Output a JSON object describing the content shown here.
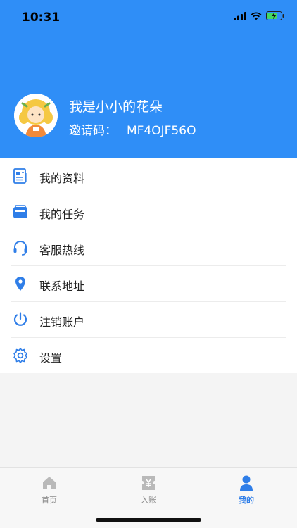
{
  "status": {
    "time": "10:31"
  },
  "profile": {
    "name": "我是小小的花朵",
    "invite_label": "邀请码：",
    "invite_code": "MF4OJF56O"
  },
  "menu": {
    "items": [
      {
        "label": "我的资料",
        "icon": "profile-document-icon"
      },
      {
        "label": "我的任务",
        "icon": "task-briefcase-icon"
      },
      {
        "label": "客服热线",
        "icon": "headset-icon"
      },
      {
        "label": "联系地址",
        "icon": "location-pin-icon"
      },
      {
        "label": "注销账户",
        "icon": "power-icon"
      },
      {
        "label": "设置",
        "icon": "gear-icon"
      }
    ]
  },
  "tabbar": {
    "tabs": [
      {
        "label": "首页",
        "icon": "home-icon",
        "active": false
      },
      {
        "label": "入账",
        "icon": "income-ticket-icon",
        "active": false
      },
      {
        "label": "我的",
        "icon": "user-icon",
        "active": true
      }
    ]
  },
  "colors": {
    "header_blue": "#2f8ef7",
    "icon_blue": "#2f7ee8",
    "tab_inactive": "#8a8a8a"
  }
}
